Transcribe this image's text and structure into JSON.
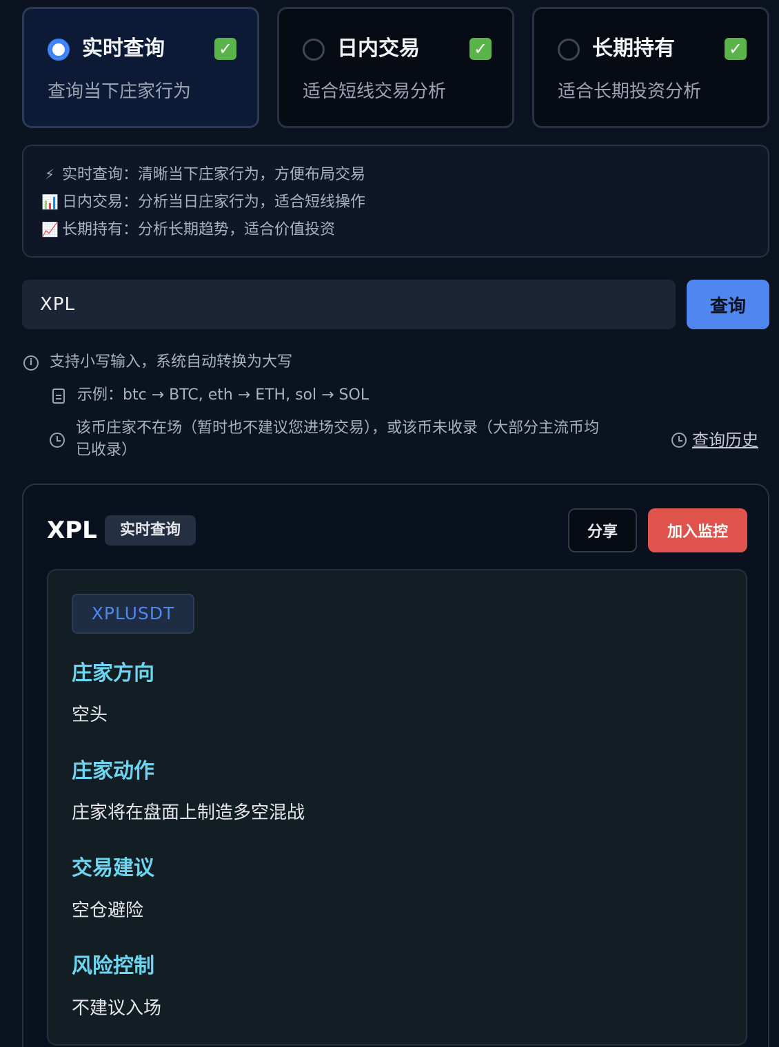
{
  "modes": [
    {
      "title": "实时查询",
      "desc": "查询当下庄家行为",
      "selected": true
    },
    {
      "title": "日内交易",
      "desc": "适合短线交易分析",
      "selected": false
    },
    {
      "title": "长期持有",
      "desc": "适合长期投资分析",
      "selected": false
    }
  ],
  "check_mark": "✓",
  "info": {
    "lines": [
      {
        "icon": "⚡",
        "icon_name": "lightning-icon",
        "text": "实时查询：清晰当下庄家行为，方便布局交易"
      },
      {
        "icon": "📊",
        "icon_name": "bar-chart-icon",
        "text": "日内交易：分析当日庄家行为，适合短线操作"
      },
      {
        "icon": "📈",
        "icon_name": "trending-up-icon",
        "text": "长期持有：分析长期趋势，适合价值投资"
      }
    ]
  },
  "search": {
    "value": "XPL",
    "button_label": "查询"
  },
  "hints": {
    "info_icon_glyph": "i",
    "lowercase": "支持小写输入，系统自动转换为大写",
    "example": "示例：btc → BTC, eth → ETH, sol → SOL",
    "not_listed_line1": "该币庄家不在场（暂时也不建议您进场交易），或该币未收录（大部分主流币均",
    "not_listed_line2": "已收录）",
    "history_link": "查询历史"
  },
  "result": {
    "symbol": "XPL",
    "mode_badge": "实时查询",
    "share_label": "分享",
    "monitor_label": "加入监控",
    "pair": "XPLUSDT",
    "sections": [
      {
        "title": "庄家方向",
        "body": "空头"
      },
      {
        "title": "庄家动作",
        "body": "庄家将在盘面上制造多空混战"
      },
      {
        "title": "交易建议",
        "body": "空仓避险"
      },
      {
        "title": "风险控制",
        "body": "不建议入场"
      }
    ]
  }
}
